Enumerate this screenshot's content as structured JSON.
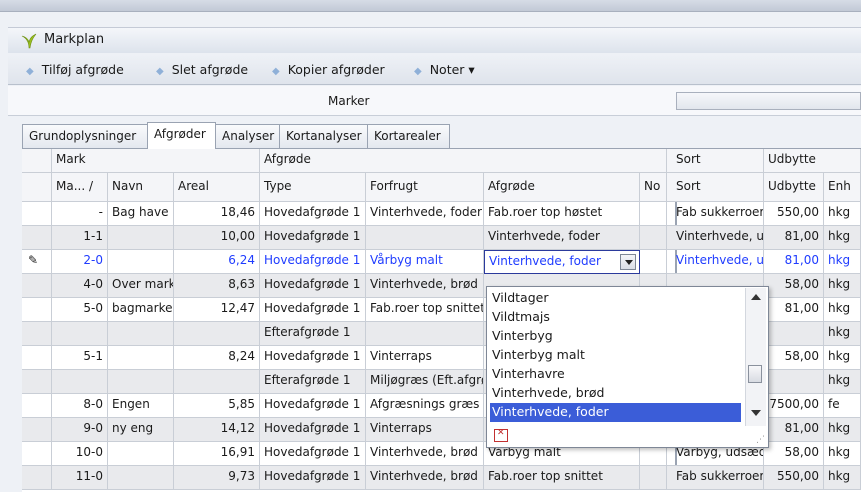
{
  "window": {
    "title": "Markplan"
  },
  "toolbar": {
    "add": "Tilføj afgrøde",
    "delete": "Slet afgrøde",
    "copy": "Kopier afgrøder",
    "notes": "Noter ▾"
  },
  "panel": {
    "title": "Marker"
  },
  "tabs": [
    "Grundoplysninger",
    "Afgrøder",
    "Analyser",
    "Kortanalyser",
    "Kortarealer"
  ],
  "active_tab": "Afgrøder",
  "grid": {
    "group_headers": {
      "mark": "Mark",
      "afgrode": "Afgrøde",
      "sort": "Sort",
      "udbytte": "Udbytte"
    },
    "columns": [
      "Ma... /",
      "Navn",
      "Areal",
      "Type",
      "Forfrugt",
      "Afgrøde",
      "No",
      "Sort",
      "Udbytte",
      "Enh"
    ],
    "rows": [
      {
        "ma": "-",
        "navn": "Bag have",
        "areal": "18,46",
        "type": "Hovedafgrøde 1",
        "forfrugt": "Vinterhvede, foder",
        "afgrode": "Fab.roer top høstet",
        "sort": "Fab sukkerroer",
        "udbytte": "550,00",
        "enh": "hkg"
      },
      {
        "ma": "1-1",
        "navn": "",
        "areal": "10,00",
        "type": "Hovedafgrøde 1",
        "forfrugt": "",
        "afgrode": "Vinterhvede, foder",
        "sort": "Vinterhvede, u",
        "udbytte": "81,00",
        "enh": "hkg"
      },
      {
        "ma": "2-0",
        "navn": "",
        "areal": "6,24",
        "type": "Hovedafgrøde 1",
        "forfrugt": "Vårbyg malt",
        "afgrode": "Vinterhvede, foder",
        "sort": "Vinterhvede, u",
        "udbytte": "81,00",
        "enh": "hkg"
      },
      {
        "ma": "4-0",
        "navn": "Over mark",
        "areal": "8,63",
        "type": "Hovedafgrøde 1",
        "forfrugt": "Vinterhvede, brød",
        "afgrode": "",
        "sort": "",
        "udbytte": "58,00",
        "enh": "hkg"
      },
      {
        "ma": "5-0",
        "navn": "bagmarken",
        "areal": "12,47",
        "type": "Hovedafgrøde 1",
        "forfrugt": "Fab.roer top snittet",
        "afgrode": "",
        "sort": "",
        "udbytte": "81,00",
        "enh": "hkg"
      },
      {
        "ma": "",
        "navn": "",
        "areal": "",
        "type": "Efterafgrøde 1",
        "forfrugt": "",
        "afgrode": "",
        "sort": "",
        "udbytte": "",
        "enh": "hkg"
      },
      {
        "ma": "5-1",
        "navn": "",
        "areal": "8,24",
        "type": "Hovedafgrøde 1",
        "forfrugt": "Vinterraps",
        "afgrode": "",
        "sort": "",
        "udbytte": "58,00",
        "enh": "hkg"
      },
      {
        "ma": "",
        "navn": "",
        "areal": "",
        "type": "Efterafgrøde 1",
        "forfrugt": "Miljøgræs (Eft.afgrøde)",
        "afgrode": "",
        "sort": "",
        "udbytte": "",
        "enh": "hkg"
      },
      {
        "ma": "8-0",
        "navn": "Engen",
        "areal": "5,85",
        "type": "Hovedafgrøde 1",
        "forfrugt": "Afgræsnings græs",
        "afgrode": "",
        "sort": "",
        "udbytte": "7500,00",
        "enh": "fe"
      },
      {
        "ma": "9-0",
        "navn": "ny eng",
        "areal": "14,12",
        "type": "Hovedafgrøde 1",
        "forfrugt": "Vinterraps",
        "afgrode": "",
        "sort": "",
        "udbytte": "81,00",
        "enh": "hkg"
      },
      {
        "ma": "10-0",
        "navn": "",
        "areal": "16,91",
        "type": "Hovedafgrøde 1",
        "forfrugt": "Vinterhvede, brød",
        "afgrode": "Vårbyg malt",
        "sort": "Vårbyg, udsæd",
        "udbytte": "58,00",
        "enh": "hkg"
      },
      {
        "ma": "11-0",
        "navn": "",
        "areal": "9,73",
        "type": "Hovedafgrøde 1",
        "forfrugt": "Vinterhvede, brød",
        "afgrode": "Fab.roer top snittet",
        "sort": "Fab sukkerroer",
        "udbytte": "550,00",
        "enh": "hkg"
      }
    ]
  },
  "dropdown": {
    "items": [
      "Vildtager",
      "Vildtmajs",
      "Vinterbyg",
      "Vinterbyg malt",
      "Vinterhavre",
      "Vinterhvede, brød",
      "Vinterhvede, foder"
    ],
    "selected": "Vinterhvede, foder",
    "scroll_position": 0.7
  },
  "colors": {
    "link_blue": "#1f3cff",
    "selection": "#3b5dd8",
    "row_grey": "#e9eaed"
  }
}
